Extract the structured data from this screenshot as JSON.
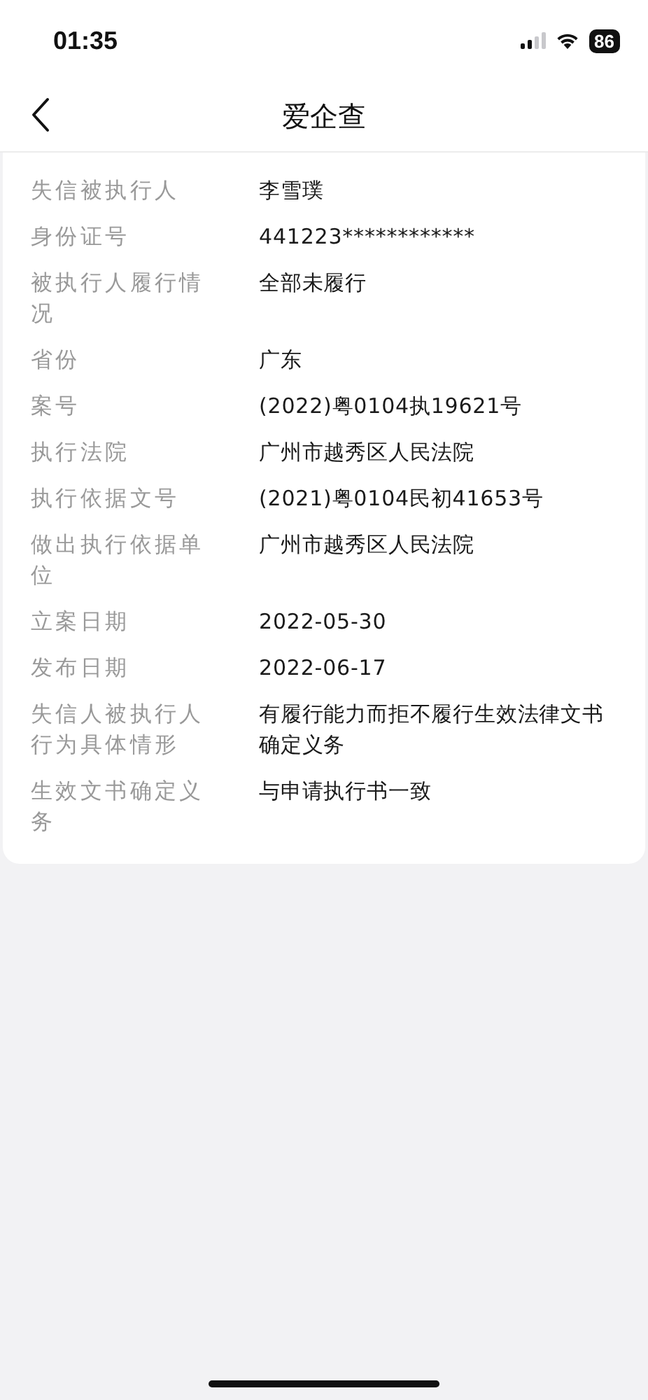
{
  "status_bar": {
    "time": "01:35",
    "battery": "86"
  },
  "nav_bar": {
    "title": "爱企查"
  },
  "details": [
    {
      "label": "失信被执行人",
      "value": "李雪璞"
    },
    {
      "label": "身份证号",
      "value": "441223************"
    },
    {
      "label": "被执行人履行情况",
      "value": "全部未履行"
    },
    {
      "label": "省份",
      "value": "广东"
    },
    {
      "label": "案号",
      "value": "(2022)粤0104执19621号"
    },
    {
      "label": "执行法院",
      "value": "广州市越秀区人民法院"
    },
    {
      "label": "执行依据文号",
      "value": "(2021)粤0104民初41653号"
    },
    {
      "label": "做出执行依据单位",
      "value": "广州市越秀区人民法院"
    },
    {
      "label": "立案日期",
      "value": "2022-05-30"
    },
    {
      "label": "发布日期",
      "value": "2022-06-17"
    },
    {
      "label": "失信人被执行人行为具体情形",
      "value": "有履行能力而拒不履行生效法律文书确定义务"
    },
    {
      "label": "生效文书确定义务",
      "value": "与申请执行书一致"
    }
  ]
}
